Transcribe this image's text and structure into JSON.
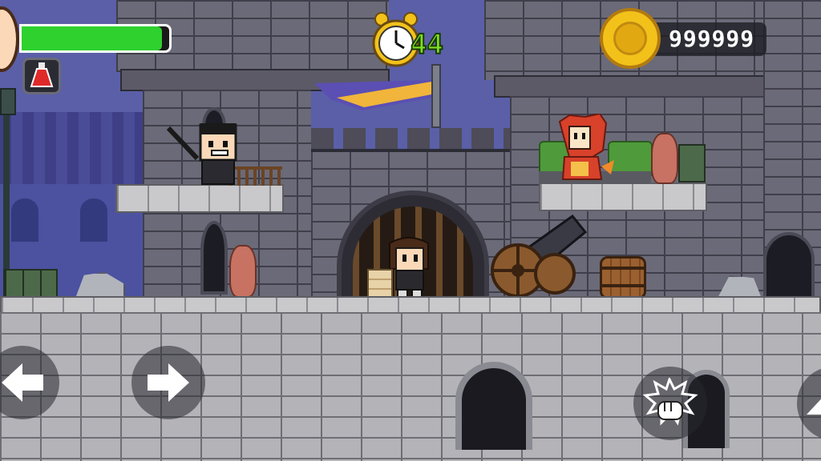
{
  "hud": {
    "timer_value": "44",
    "coin_count": "999999",
    "health_fraction": 0.95,
    "potion_icon": "red-potion-icon"
  },
  "controls": {
    "left_icon": "arrow-left-icon",
    "right_icon": "arrow-right-icon",
    "punch_icon": "fist-punch-icon",
    "jump_icon": "arrow-up-icon"
  },
  "colors": {
    "health_bar": "#2fd12f",
    "coin_gold": "#f2c21a",
    "banner_purple": "#5b4fb3",
    "banner_gold": "#f0b53a",
    "dragon_red": "#d8412a"
  }
}
